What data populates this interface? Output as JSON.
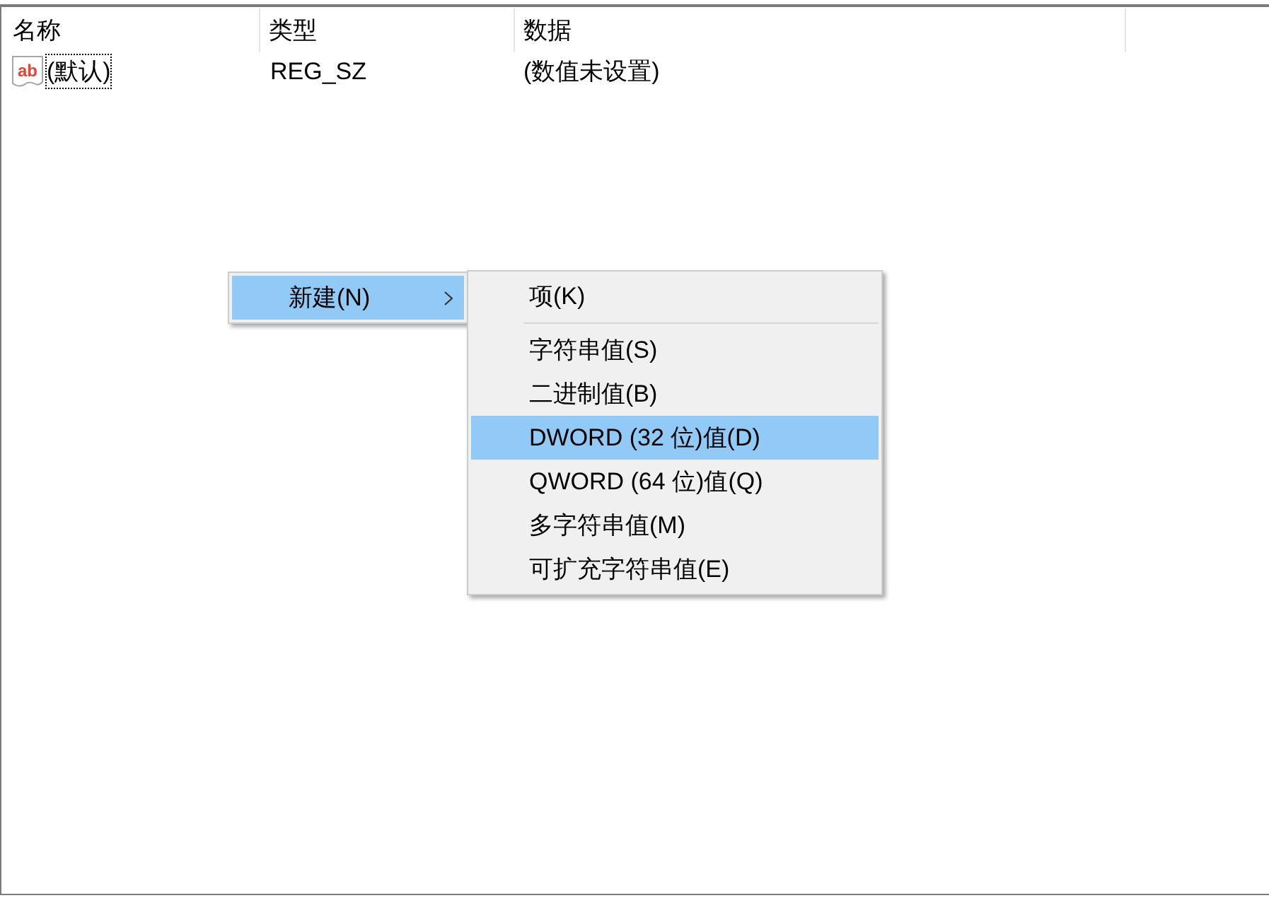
{
  "columns": [
    {
      "label": "名称"
    },
    {
      "label": "类型"
    },
    {
      "label": "数据"
    }
  ],
  "rows": [
    {
      "icon_label": "ab",
      "name": "(默认)",
      "type": "REG_SZ",
      "data": "(数值未设置)",
      "focused": true
    }
  ],
  "context_menu": {
    "items": [
      {
        "label": "新建(N)",
        "selected": true,
        "submenu": true
      }
    ]
  },
  "submenu": {
    "items": [
      {
        "kind": "item",
        "label": "项(K)",
        "selected": false
      },
      {
        "kind": "separator"
      },
      {
        "kind": "item",
        "label": "字符串值(S)",
        "selected": false
      },
      {
        "kind": "item",
        "label": "二进制值(B)",
        "selected": false
      },
      {
        "kind": "item",
        "label": "DWORD (32 位)值(D)",
        "selected": true
      },
      {
        "kind": "item",
        "label": "QWORD (64 位)值(Q)",
        "selected": false
      },
      {
        "kind": "item",
        "label": "多字符串值(M)",
        "selected": false
      },
      {
        "kind": "item",
        "label": "可扩充字符串值(E)",
        "selected": false
      }
    ]
  }
}
